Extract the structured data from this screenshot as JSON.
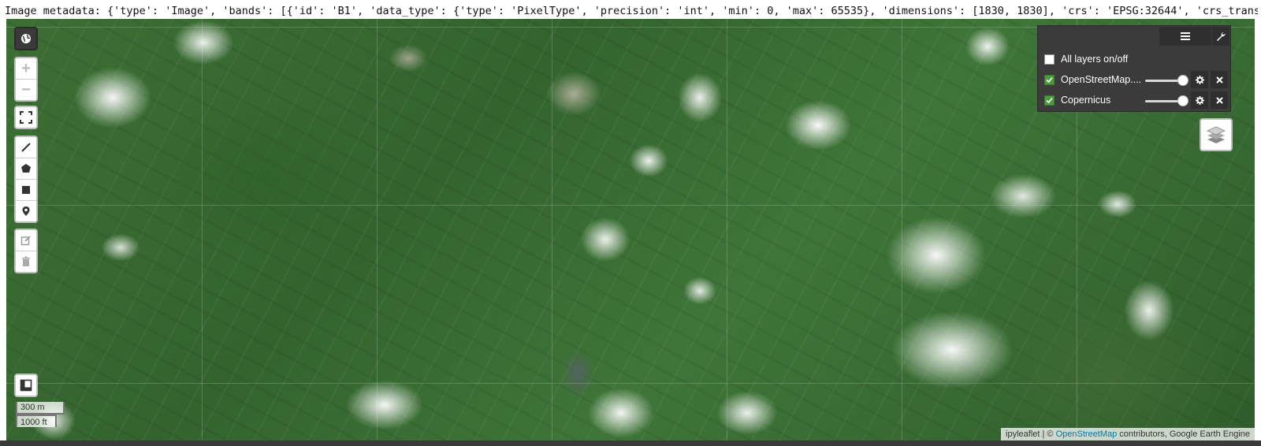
{
  "metadata_text": "Image metadata: {'type': 'Image', 'bands': [{'id': 'B1', 'data_type': {'type': 'PixelType', 'precision': 'int', 'min': 0, 'max': 65535}, 'dimensions': [1830, 1830], 'crs': 'EPSG:32644', 'crs_transform': [60, 0, 49",
  "zoom": {
    "in_label": "+",
    "out_label": "−"
  },
  "layers_panel": {
    "all_label": "All layers on/off",
    "layers": [
      {
        "name": "OpenStreetMap....",
        "visible": true,
        "opacity": 1.0
      },
      {
        "name": "Copernicus",
        "visible": true,
        "opacity": 1.0
      }
    ]
  },
  "scale": {
    "metric": "300 m",
    "imperial": "1000 ft"
  },
  "attribution": {
    "prefix": "ipyleaflet",
    "separator": " | © ",
    "osm_link": "OpenStreetMap",
    "suffix": " contributors, Google Earth Engine"
  },
  "colors": {
    "panel_bg": "#3b3b3b",
    "checkbox_on": "#4a9d3a",
    "link": "#0078a8"
  },
  "icons": [
    "globe-icon",
    "fullscreen-icon",
    "polyline-icon",
    "polygon-icon",
    "rectangle-icon",
    "marker-icon",
    "edit-icon",
    "trash-icon",
    "layers-icon",
    "wrench-icon",
    "list-icon",
    "gear-icon",
    "close-icon",
    "split-map-icon"
  ]
}
